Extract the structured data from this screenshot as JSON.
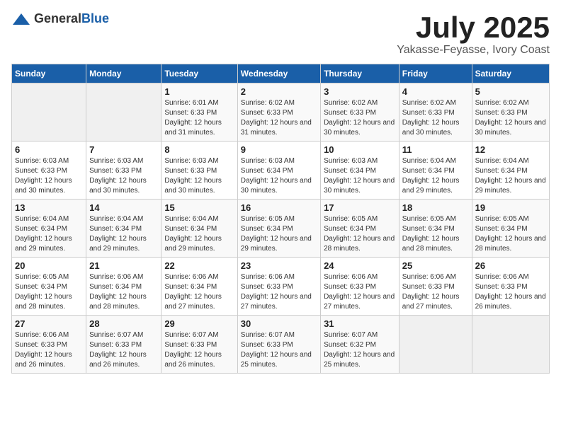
{
  "logo": {
    "text_general": "General",
    "text_blue": "Blue"
  },
  "title": "July 2025",
  "subtitle": "Yakasse-Feyasse, Ivory Coast",
  "weekdays": [
    "Sunday",
    "Monday",
    "Tuesday",
    "Wednesday",
    "Thursday",
    "Friday",
    "Saturday"
  ],
  "weeks": [
    [
      {
        "day": "",
        "sunrise": "",
        "sunset": "",
        "daylight": "",
        "empty": true
      },
      {
        "day": "",
        "sunrise": "",
        "sunset": "",
        "daylight": "",
        "empty": true
      },
      {
        "day": "1",
        "sunrise": "Sunrise: 6:01 AM",
        "sunset": "Sunset: 6:33 PM",
        "daylight": "Daylight: 12 hours and 31 minutes."
      },
      {
        "day": "2",
        "sunrise": "Sunrise: 6:02 AM",
        "sunset": "Sunset: 6:33 PM",
        "daylight": "Daylight: 12 hours and 31 minutes."
      },
      {
        "day": "3",
        "sunrise": "Sunrise: 6:02 AM",
        "sunset": "Sunset: 6:33 PM",
        "daylight": "Daylight: 12 hours and 30 minutes."
      },
      {
        "day": "4",
        "sunrise": "Sunrise: 6:02 AM",
        "sunset": "Sunset: 6:33 PM",
        "daylight": "Daylight: 12 hours and 30 minutes."
      },
      {
        "day": "5",
        "sunrise": "Sunrise: 6:02 AM",
        "sunset": "Sunset: 6:33 PM",
        "daylight": "Daylight: 12 hours and 30 minutes."
      }
    ],
    [
      {
        "day": "6",
        "sunrise": "Sunrise: 6:03 AM",
        "sunset": "Sunset: 6:33 PM",
        "daylight": "Daylight: 12 hours and 30 minutes."
      },
      {
        "day": "7",
        "sunrise": "Sunrise: 6:03 AM",
        "sunset": "Sunset: 6:33 PM",
        "daylight": "Daylight: 12 hours and 30 minutes."
      },
      {
        "day": "8",
        "sunrise": "Sunrise: 6:03 AM",
        "sunset": "Sunset: 6:33 PM",
        "daylight": "Daylight: 12 hours and 30 minutes."
      },
      {
        "day": "9",
        "sunrise": "Sunrise: 6:03 AM",
        "sunset": "Sunset: 6:34 PM",
        "daylight": "Daylight: 12 hours and 30 minutes."
      },
      {
        "day": "10",
        "sunrise": "Sunrise: 6:03 AM",
        "sunset": "Sunset: 6:34 PM",
        "daylight": "Daylight: 12 hours and 30 minutes."
      },
      {
        "day": "11",
        "sunrise": "Sunrise: 6:04 AM",
        "sunset": "Sunset: 6:34 PM",
        "daylight": "Daylight: 12 hours and 29 minutes."
      },
      {
        "day": "12",
        "sunrise": "Sunrise: 6:04 AM",
        "sunset": "Sunset: 6:34 PM",
        "daylight": "Daylight: 12 hours and 29 minutes."
      }
    ],
    [
      {
        "day": "13",
        "sunrise": "Sunrise: 6:04 AM",
        "sunset": "Sunset: 6:34 PM",
        "daylight": "Daylight: 12 hours and 29 minutes."
      },
      {
        "day": "14",
        "sunrise": "Sunrise: 6:04 AM",
        "sunset": "Sunset: 6:34 PM",
        "daylight": "Daylight: 12 hours and 29 minutes."
      },
      {
        "day": "15",
        "sunrise": "Sunrise: 6:04 AM",
        "sunset": "Sunset: 6:34 PM",
        "daylight": "Daylight: 12 hours and 29 minutes."
      },
      {
        "day": "16",
        "sunrise": "Sunrise: 6:05 AM",
        "sunset": "Sunset: 6:34 PM",
        "daylight": "Daylight: 12 hours and 29 minutes."
      },
      {
        "day": "17",
        "sunrise": "Sunrise: 6:05 AM",
        "sunset": "Sunset: 6:34 PM",
        "daylight": "Daylight: 12 hours and 28 minutes."
      },
      {
        "day": "18",
        "sunrise": "Sunrise: 6:05 AM",
        "sunset": "Sunset: 6:34 PM",
        "daylight": "Daylight: 12 hours and 28 minutes."
      },
      {
        "day": "19",
        "sunrise": "Sunrise: 6:05 AM",
        "sunset": "Sunset: 6:34 PM",
        "daylight": "Daylight: 12 hours and 28 minutes."
      }
    ],
    [
      {
        "day": "20",
        "sunrise": "Sunrise: 6:05 AM",
        "sunset": "Sunset: 6:34 PM",
        "daylight": "Daylight: 12 hours and 28 minutes."
      },
      {
        "day": "21",
        "sunrise": "Sunrise: 6:06 AM",
        "sunset": "Sunset: 6:34 PM",
        "daylight": "Daylight: 12 hours and 28 minutes."
      },
      {
        "day": "22",
        "sunrise": "Sunrise: 6:06 AM",
        "sunset": "Sunset: 6:34 PM",
        "daylight": "Daylight: 12 hours and 27 minutes."
      },
      {
        "day": "23",
        "sunrise": "Sunrise: 6:06 AM",
        "sunset": "Sunset: 6:33 PM",
        "daylight": "Daylight: 12 hours and 27 minutes."
      },
      {
        "day": "24",
        "sunrise": "Sunrise: 6:06 AM",
        "sunset": "Sunset: 6:33 PM",
        "daylight": "Daylight: 12 hours and 27 minutes."
      },
      {
        "day": "25",
        "sunrise": "Sunrise: 6:06 AM",
        "sunset": "Sunset: 6:33 PM",
        "daylight": "Daylight: 12 hours and 27 minutes."
      },
      {
        "day": "26",
        "sunrise": "Sunrise: 6:06 AM",
        "sunset": "Sunset: 6:33 PM",
        "daylight": "Daylight: 12 hours and 26 minutes."
      }
    ],
    [
      {
        "day": "27",
        "sunrise": "Sunrise: 6:06 AM",
        "sunset": "Sunset: 6:33 PM",
        "daylight": "Daylight: 12 hours and 26 minutes."
      },
      {
        "day": "28",
        "sunrise": "Sunrise: 6:07 AM",
        "sunset": "Sunset: 6:33 PM",
        "daylight": "Daylight: 12 hours and 26 minutes."
      },
      {
        "day": "29",
        "sunrise": "Sunrise: 6:07 AM",
        "sunset": "Sunset: 6:33 PM",
        "daylight": "Daylight: 12 hours and 26 minutes."
      },
      {
        "day": "30",
        "sunrise": "Sunrise: 6:07 AM",
        "sunset": "Sunset: 6:33 PM",
        "daylight": "Daylight: 12 hours and 25 minutes."
      },
      {
        "day": "31",
        "sunrise": "Sunrise: 6:07 AM",
        "sunset": "Sunset: 6:32 PM",
        "daylight": "Daylight: 12 hours and 25 minutes."
      },
      {
        "day": "",
        "sunrise": "",
        "sunset": "",
        "daylight": "",
        "empty": true
      },
      {
        "day": "",
        "sunrise": "",
        "sunset": "",
        "daylight": "",
        "empty": true
      }
    ]
  ]
}
